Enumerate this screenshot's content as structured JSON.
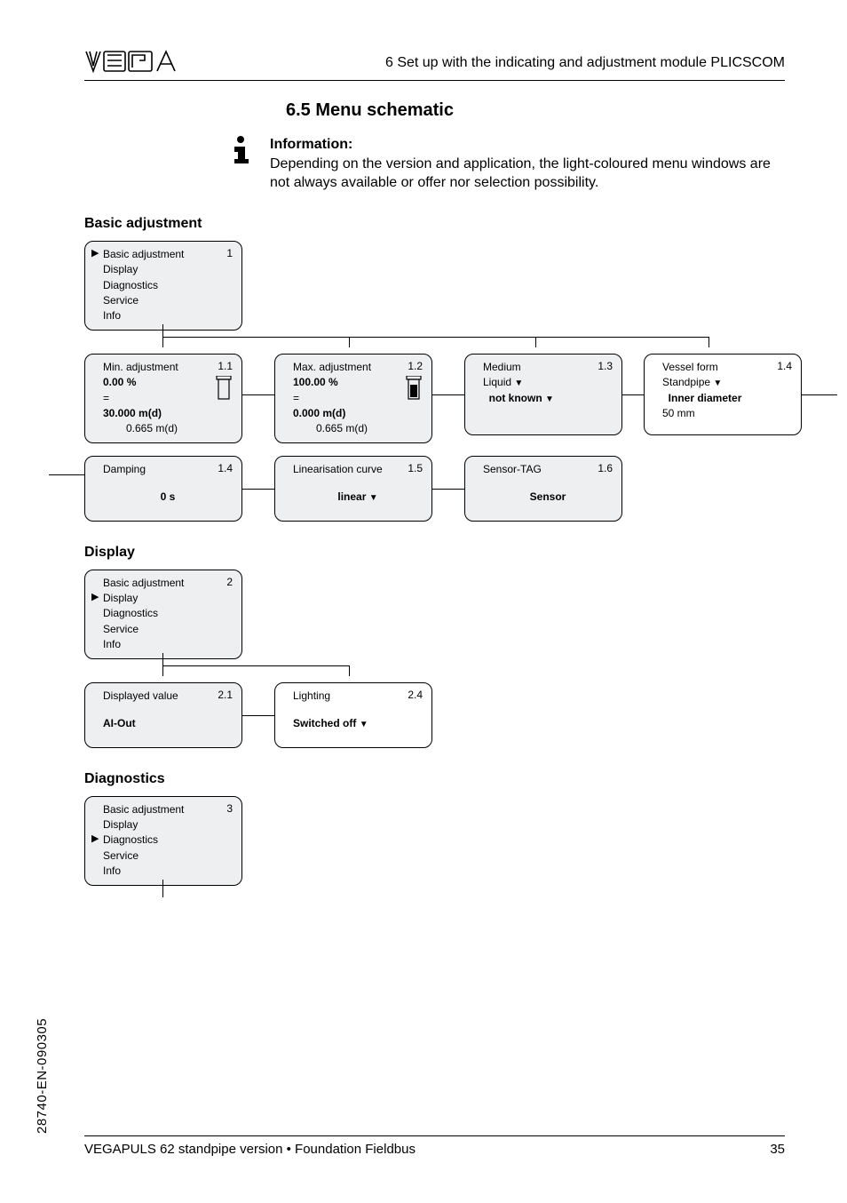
{
  "header": {
    "section": "6  Set up with the indicating and adjustment module PLICSCOM"
  },
  "title": "6.5   Menu schematic",
  "info": {
    "label": "Information:",
    "text": "Depending on the version and application, the light-coloured menu windows are not always available or offer nor selection possibility."
  },
  "sections": {
    "basic": "Basic adjustment",
    "display": "Display",
    "diagnostics": "Diagnostics"
  },
  "menu_main": {
    "items": [
      "Basic adjustment",
      "Display",
      "Diagnostics",
      "Service",
      "Info"
    ]
  },
  "basic": {
    "main_num": "1",
    "min": {
      "num": "1.1",
      "title": "Min. adjustment",
      "l1": "0.00 %",
      "l2": "=",
      "l3": "30.000 m(d)",
      "l4": "0.665 m(d)"
    },
    "max": {
      "num": "1.2",
      "title": "Max. adjustment",
      "l1": "100.00 %",
      "l2": "=",
      "l3": "0.000 m(d)",
      "l4": "0.665 m(d)"
    },
    "medium": {
      "num": "1.3",
      "title": "Medium",
      "l1": "Liquid",
      "l2": "not known"
    },
    "vessel": {
      "num": "1.4",
      "title": "Vessel form",
      "l1": "Standpipe",
      "l2": "Inner diameter",
      "l3": "50 mm"
    },
    "damping": {
      "num": "1.4",
      "title": "Damping",
      "value": "0 s"
    },
    "lin": {
      "num": "1.5",
      "title": "Linearisation curve",
      "value": "linear"
    },
    "tag": {
      "num": "1.6",
      "title": "Sensor-TAG",
      "value": "Sensor"
    }
  },
  "display": {
    "main_num": "2",
    "value": {
      "num": "2.1",
      "title": "Displayed value",
      "value": "AI-Out"
    },
    "light": {
      "num": "2.4",
      "title": "Lighting",
      "value": "Switched off"
    }
  },
  "diagnostics": {
    "main_num": "3"
  },
  "footer": {
    "left": "VEGAPULS 62 standpipe version • Foundation Fieldbus",
    "right": "35"
  },
  "sidecode": "28740-EN-090305"
}
